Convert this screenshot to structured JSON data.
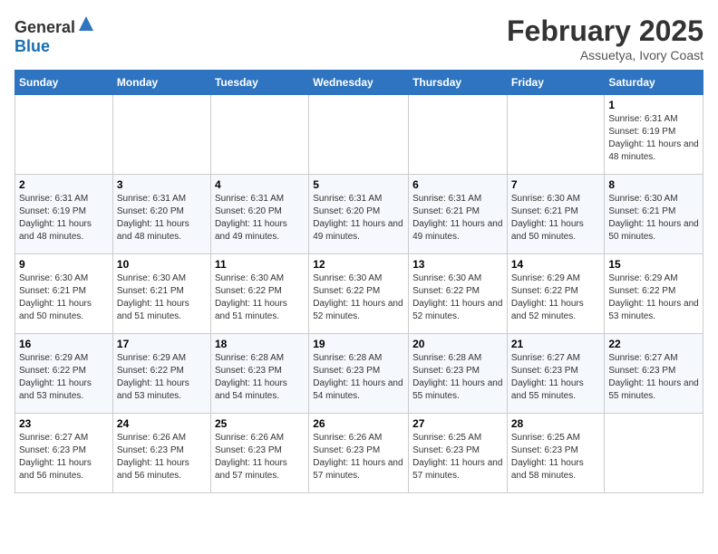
{
  "header": {
    "logo_general": "General",
    "logo_blue": "Blue",
    "month_year": "February 2025",
    "location": "Assuetya, Ivory Coast"
  },
  "days_of_week": [
    "Sunday",
    "Monday",
    "Tuesday",
    "Wednesday",
    "Thursday",
    "Friday",
    "Saturday"
  ],
  "weeks": [
    [
      {
        "day": "",
        "info": ""
      },
      {
        "day": "",
        "info": ""
      },
      {
        "day": "",
        "info": ""
      },
      {
        "day": "",
        "info": ""
      },
      {
        "day": "",
        "info": ""
      },
      {
        "day": "",
        "info": ""
      },
      {
        "day": "1",
        "info": "Sunrise: 6:31 AM\nSunset: 6:19 PM\nDaylight: 11 hours and 48 minutes."
      }
    ],
    [
      {
        "day": "2",
        "info": "Sunrise: 6:31 AM\nSunset: 6:19 PM\nDaylight: 11 hours and 48 minutes."
      },
      {
        "day": "3",
        "info": "Sunrise: 6:31 AM\nSunset: 6:20 PM\nDaylight: 11 hours and 48 minutes."
      },
      {
        "day": "4",
        "info": "Sunrise: 6:31 AM\nSunset: 6:20 PM\nDaylight: 11 hours and 49 minutes."
      },
      {
        "day": "5",
        "info": "Sunrise: 6:31 AM\nSunset: 6:20 PM\nDaylight: 11 hours and 49 minutes."
      },
      {
        "day": "6",
        "info": "Sunrise: 6:31 AM\nSunset: 6:21 PM\nDaylight: 11 hours and 49 minutes."
      },
      {
        "day": "7",
        "info": "Sunrise: 6:30 AM\nSunset: 6:21 PM\nDaylight: 11 hours and 50 minutes."
      },
      {
        "day": "8",
        "info": "Sunrise: 6:30 AM\nSunset: 6:21 PM\nDaylight: 11 hours and 50 minutes."
      }
    ],
    [
      {
        "day": "9",
        "info": "Sunrise: 6:30 AM\nSunset: 6:21 PM\nDaylight: 11 hours and 50 minutes."
      },
      {
        "day": "10",
        "info": "Sunrise: 6:30 AM\nSunset: 6:21 PM\nDaylight: 11 hours and 51 minutes."
      },
      {
        "day": "11",
        "info": "Sunrise: 6:30 AM\nSunset: 6:22 PM\nDaylight: 11 hours and 51 minutes."
      },
      {
        "day": "12",
        "info": "Sunrise: 6:30 AM\nSunset: 6:22 PM\nDaylight: 11 hours and 52 minutes."
      },
      {
        "day": "13",
        "info": "Sunrise: 6:30 AM\nSunset: 6:22 PM\nDaylight: 11 hours and 52 minutes."
      },
      {
        "day": "14",
        "info": "Sunrise: 6:29 AM\nSunset: 6:22 PM\nDaylight: 11 hours and 52 minutes."
      },
      {
        "day": "15",
        "info": "Sunrise: 6:29 AM\nSunset: 6:22 PM\nDaylight: 11 hours and 53 minutes."
      }
    ],
    [
      {
        "day": "16",
        "info": "Sunrise: 6:29 AM\nSunset: 6:22 PM\nDaylight: 11 hours and 53 minutes."
      },
      {
        "day": "17",
        "info": "Sunrise: 6:29 AM\nSunset: 6:22 PM\nDaylight: 11 hours and 53 minutes."
      },
      {
        "day": "18",
        "info": "Sunrise: 6:28 AM\nSunset: 6:23 PM\nDaylight: 11 hours and 54 minutes."
      },
      {
        "day": "19",
        "info": "Sunrise: 6:28 AM\nSunset: 6:23 PM\nDaylight: 11 hours and 54 minutes."
      },
      {
        "day": "20",
        "info": "Sunrise: 6:28 AM\nSunset: 6:23 PM\nDaylight: 11 hours and 55 minutes."
      },
      {
        "day": "21",
        "info": "Sunrise: 6:27 AM\nSunset: 6:23 PM\nDaylight: 11 hours and 55 minutes."
      },
      {
        "day": "22",
        "info": "Sunrise: 6:27 AM\nSunset: 6:23 PM\nDaylight: 11 hours and 55 minutes."
      }
    ],
    [
      {
        "day": "23",
        "info": "Sunrise: 6:27 AM\nSunset: 6:23 PM\nDaylight: 11 hours and 56 minutes."
      },
      {
        "day": "24",
        "info": "Sunrise: 6:26 AM\nSunset: 6:23 PM\nDaylight: 11 hours and 56 minutes."
      },
      {
        "day": "25",
        "info": "Sunrise: 6:26 AM\nSunset: 6:23 PM\nDaylight: 11 hours and 57 minutes."
      },
      {
        "day": "26",
        "info": "Sunrise: 6:26 AM\nSunset: 6:23 PM\nDaylight: 11 hours and 57 minutes."
      },
      {
        "day": "27",
        "info": "Sunrise: 6:25 AM\nSunset: 6:23 PM\nDaylight: 11 hours and 57 minutes."
      },
      {
        "day": "28",
        "info": "Sunrise: 6:25 AM\nSunset: 6:23 PM\nDaylight: 11 hours and 58 minutes."
      },
      {
        "day": "",
        "info": ""
      }
    ]
  ]
}
